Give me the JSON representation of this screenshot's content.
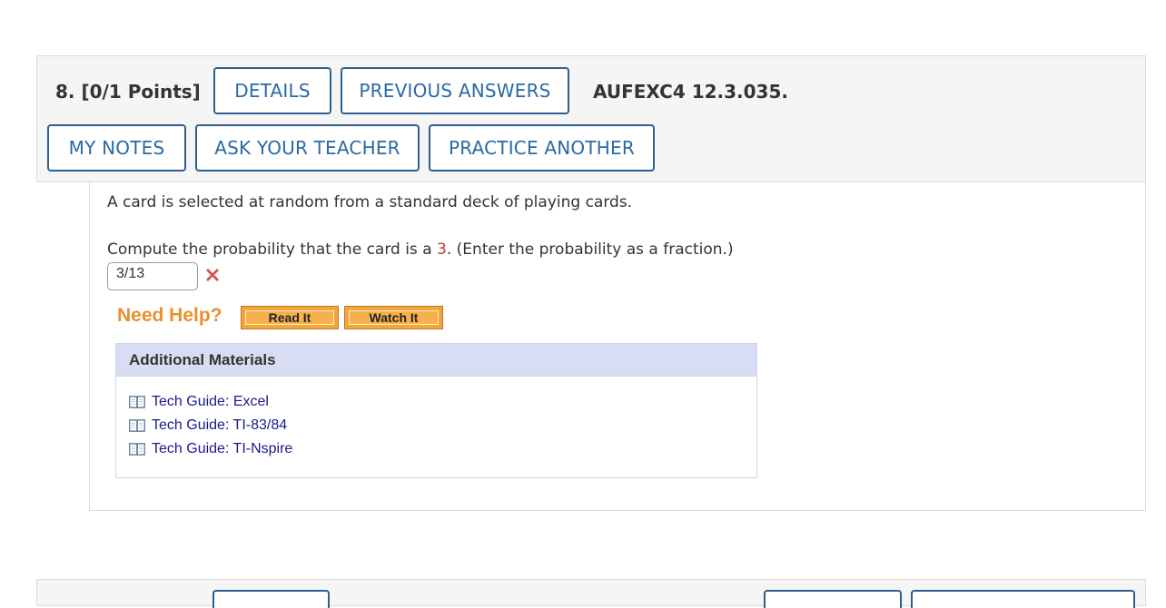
{
  "header": {
    "question_number": "8.",
    "points": "[0/1 Points]",
    "buttons": {
      "details": "DETAILS",
      "previous_answers": "PREVIOUS ANSWERS",
      "my_notes": "MY NOTES",
      "ask_teacher": "ASK YOUR TEACHER",
      "practice_another": "PRACTICE ANOTHER"
    },
    "problem_code": "AUFEXC4 12.3.035."
  },
  "question": {
    "prompt_line1": "A card is selected at random from a standard deck of playing cards.",
    "prompt_line2_before": "Compute the probability that the card is a ",
    "prompt_highlight": "3",
    "prompt_line2_after": ". (Enter the probability as a fraction.)",
    "answer_value": "3/13",
    "answer_status": "incorrect",
    "status_icon": "red-x-icon"
  },
  "need_help": {
    "label": "Need Help?",
    "read_it": "Read It",
    "watch_it": "Watch It"
  },
  "additional_materials": {
    "title": "Additional Materials",
    "items": [
      {
        "label": "Tech Guide: Excel",
        "icon": "book-icon"
      },
      {
        "label": "Tech Guide: TI-83/84",
        "icon": "book-icon"
      },
      {
        "label": "Tech Guide: TI-Nspire",
        "icon": "book-icon"
      }
    ]
  },
  "colors": {
    "button_border": "#2f5f8e",
    "button_text": "#2a6aa3",
    "need_help": "#e8902b",
    "help_button": "#f5a43a",
    "incorrect": "#d9534f",
    "highlight": "#c0392b",
    "materials_header": "#d8ddf3",
    "link": "#1a1a8c"
  }
}
